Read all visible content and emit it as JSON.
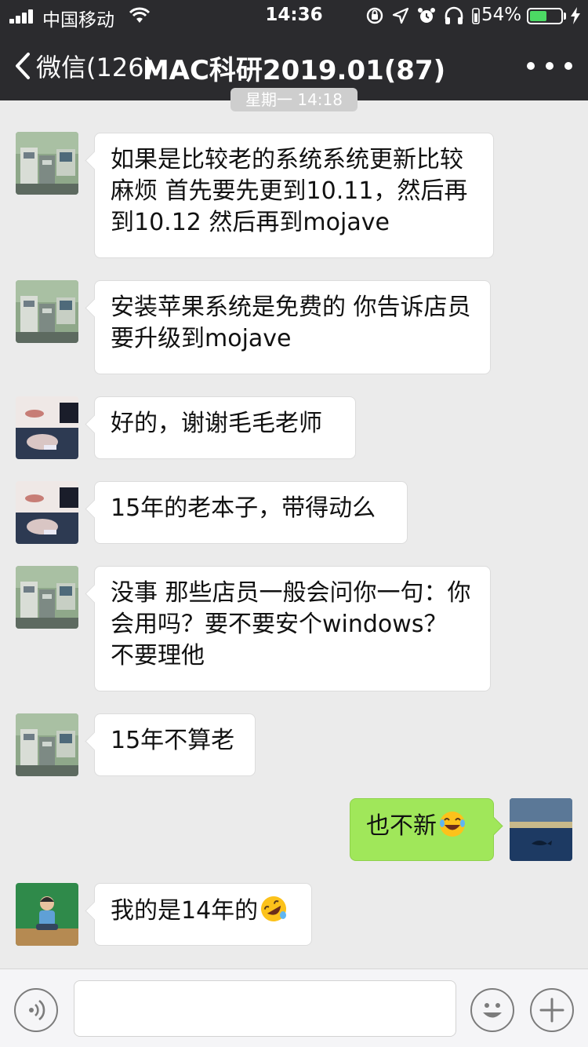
{
  "status_bar": {
    "carrier": "中国移动",
    "time": "14:36",
    "battery_percent_text": "54%",
    "battery_level": 0.54
  },
  "nav": {
    "back_label": "微信(126)",
    "title": "MAC科研2019.01(87)"
  },
  "timestamp": "星期一 14:18",
  "messages": [
    {
      "side": "left",
      "avatar": "lab-equipment-photo",
      "text": "如果是比较老的系统系统更新比较麻烦 首先要先更到10.11，然后再到10.12 然后再到mojave"
    },
    {
      "side": "left",
      "avatar": "lab-equipment-photo",
      "text": "安装苹果系统是免费的 你告诉店员要升级到mojave"
    },
    {
      "side": "left",
      "avatar": "face-closeup-photo",
      "text": "好的，谢谢毛毛老师"
    },
    {
      "side": "left",
      "avatar": "face-closeup-photo",
      "text": "15年的老本子，带得动么"
    },
    {
      "side": "left",
      "avatar": "lab-equipment-photo",
      "text": "没事 那些店员一般会问你一句：你会用吗？要不要安个windows？ 不要理他"
    },
    {
      "side": "left",
      "avatar": "lab-equipment-photo",
      "text": "15年不算老"
    },
    {
      "side": "right",
      "avatar": "ocean-whale-painting",
      "text": "也不新",
      "emoji": "tears-of-joy-emoji"
    },
    {
      "side": "left",
      "avatar": "child-photo",
      "text": "我的是14年的",
      "emoji": "rolling-laughing-emoji"
    }
  ],
  "input_bar": {
    "placeholder": "",
    "icons": [
      "voice-icon",
      "emoji-icon",
      "plus-icon"
    ]
  },
  "colors": {
    "nav_bg": "#2b2b2e",
    "chat_bg": "#ebebeb",
    "my_bubble": "#a0e75a",
    "other_bubble": "#ffffff",
    "battery_fill": "#4cd964"
  }
}
